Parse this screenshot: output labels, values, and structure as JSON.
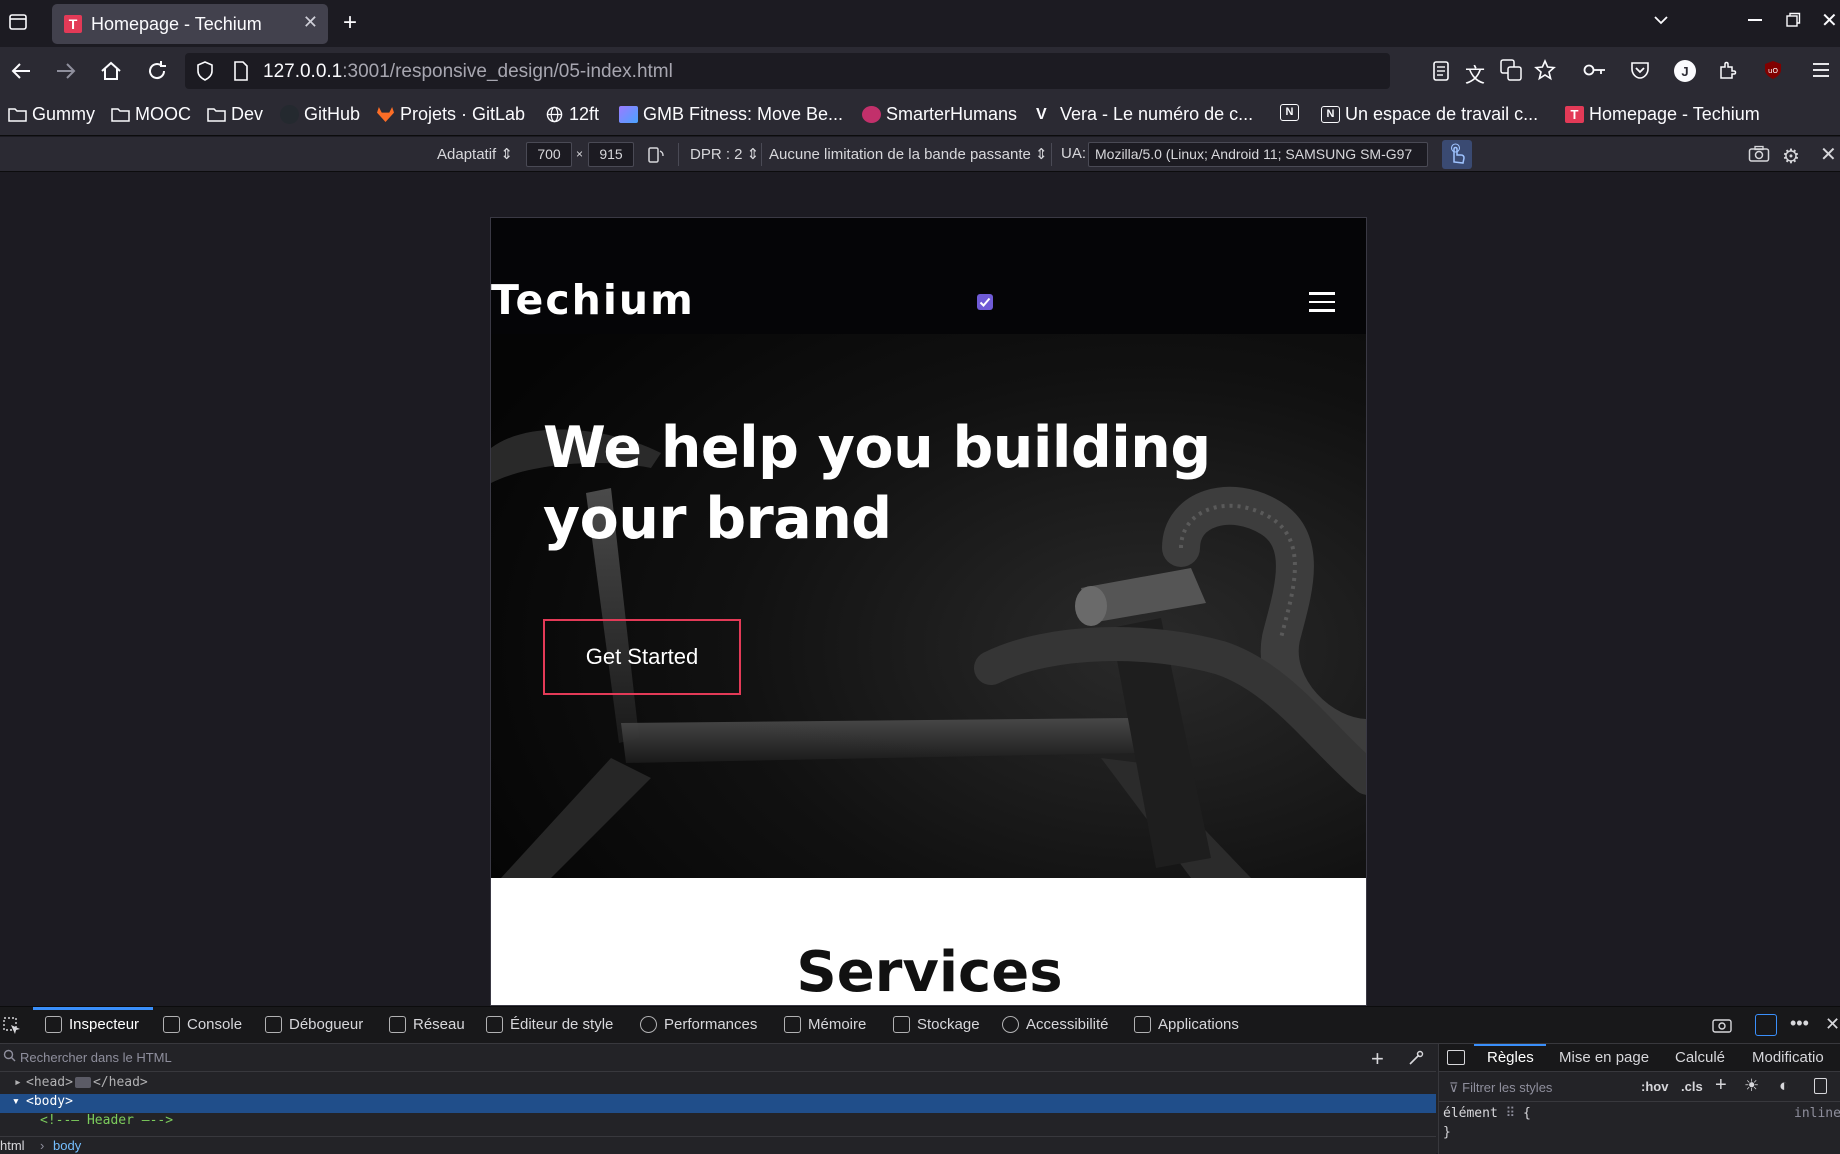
{
  "browser": {
    "tab": {
      "title": "Homepage - Techium",
      "favicon_letter": "T"
    },
    "url": {
      "host": "127.0.0.1",
      "rest": ":3001/responsive_design/05-index.html"
    },
    "bookmarks": [
      {
        "label": "Gummy",
        "icon": "folder-icon"
      },
      {
        "label": "MOOC",
        "icon": "folder-icon"
      },
      {
        "label": "Dev",
        "icon": "folder-icon"
      },
      {
        "label": "GitHub",
        "icon": "github-icon"
      },
      {
        "label": "Projets · GitLab",
        "icon": "gitlab-icon"
      },
      {
        "label": "12ft",
        "icon": "globe-icon"
      },
      {
        "label": "GMB Fitness: Move Be...",
        "icon": "gmb-icon"
      },
      {
        "label": "SmarterHumans",
        "icon": "brain-icon"
      },
      {
        "label": "Vera - Le numéro de c...",
        "icon": "vera-icon"
      },
      {
        "label": "",
        "icon": "notion-icon"
      },
      {
        "label": "Un espace de travail c...",
        "icon": "notion-icon"
      },
      {
        "label": "Homepage - Techium",
        "icon": "techium-icon"
      }
    ]
  },
  "rdm": {
    "mode": "Adaptatif",
    "width": "700",
    "times": "×",
    "height": "915",
    "dpr": "DPR : 2",
    "throttle": "Aucune limitation de la bande passante",
    "ua_label": "UA:",
    "ua_value": "Mozilla/5.0 (Linux; Android 11; SAMSUNG SM-G97"
  },
  "site": {
    "logo": "Techium",
    "hero_title": "We help you building your brand",
    "cta": "Get Started",
    "services_title": "Services"
  },
  "devtools": {
    "tabs": [
      "Inspecteur",
      "Console",
      "Débogueur",
      "Réseau",
      "Éditeur de style",
      "Performances",
      "Mémoire",
      "Stockage",
      "Accessibilité",
      "Applications"
    ],
    "search_placeholder": "Rechercher dans le HTML",
    "markup_lines": [
      "<head>",
      "</head>",
      "<body>",
      "<!--— Header —-->"
    ],
    "breadcrumbs": [
      "html",
      "body"
    ],
    "side_tabs": [
      "Règles",
      "Mise en page",
      "Calculé",
      "Modificatio"
    ],
    "filter_placeholder": "Filtrer les styles",
    "hov": ":hov",
    "cls": ".cls",
    "rule_selector": "élément",
    "rule_open": "{",
    "rule_close": "}",
    "rule_inline": "inline"
  },
  "colors": {
    "accent": "#e33a57",
    "devtools_selection": "#204e8a",
    "devtools_active_tab": "#3a8ffb"
  }
}
